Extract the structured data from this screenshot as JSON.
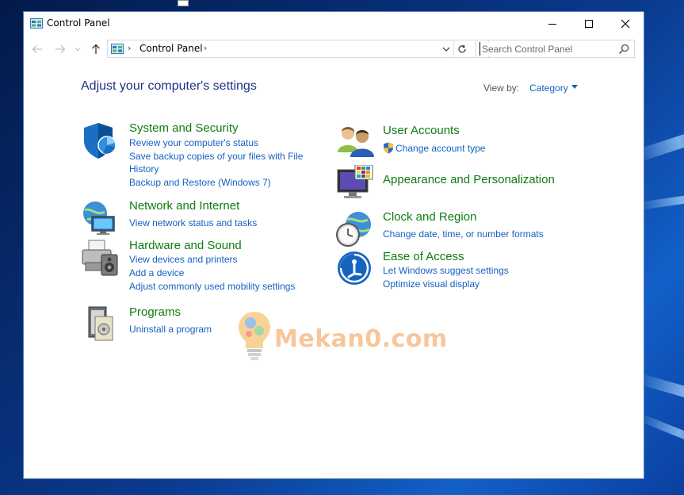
{
  "window": {
    "title": "Control Panel"
  },
  "navigation": {
    "breadcrumb": "Control Panel",
    "search_placeholder": "Search Control Panel"
  },
  "main": {
    "heading": "Adjust your computer's settings",
    "view_by_label": "View by:",
    "view_by_value": "Category"
  },
  "categories_left": [
    {
      "title": "System and Security",
      "links": [
        "Review your computer's status",
        "Save backup copies of your files with File History",
        "Backup and Restore (Windows 7)"
      ]
    },
    {
      "title": "Network and Internet",
      "links": [
        "View network status and tasks"
      ]
    },
    {
      "title": "Hardware and Sound",
      "links": [
        "View devices and printers",
        "Add a device",
        "Adjust commonly used mobility settings"
      ]
    },
    {
      "title": "Programs",
      "links": [
        "Uninstall a program"
      ]
    }
  ],
  "categories_right": [
    {
      "title": "User Accounts",
      "links": [
        "Change account type"
      ]
    },
    {
      "title": "Appearance and Personalization",
      "links": []
    },
    {
      "title": "Clock and Region",
      "links": [
        "Change date, time, or number formats"
      ]
    },
    {
      "title": "Ease of Access",
      "links": [
        "Let Windows suggest settings",
        "Optimize visual display"
      ]
    }
  ],
  "watermark": {
    "text": "Mekan0.com"
  },
  "colors": {
    "category_title": "#107c10",
    "link": "#1660c2",
    "heading": "#1e3287",
    "desktop": "#0a3a8f"
  }
}
